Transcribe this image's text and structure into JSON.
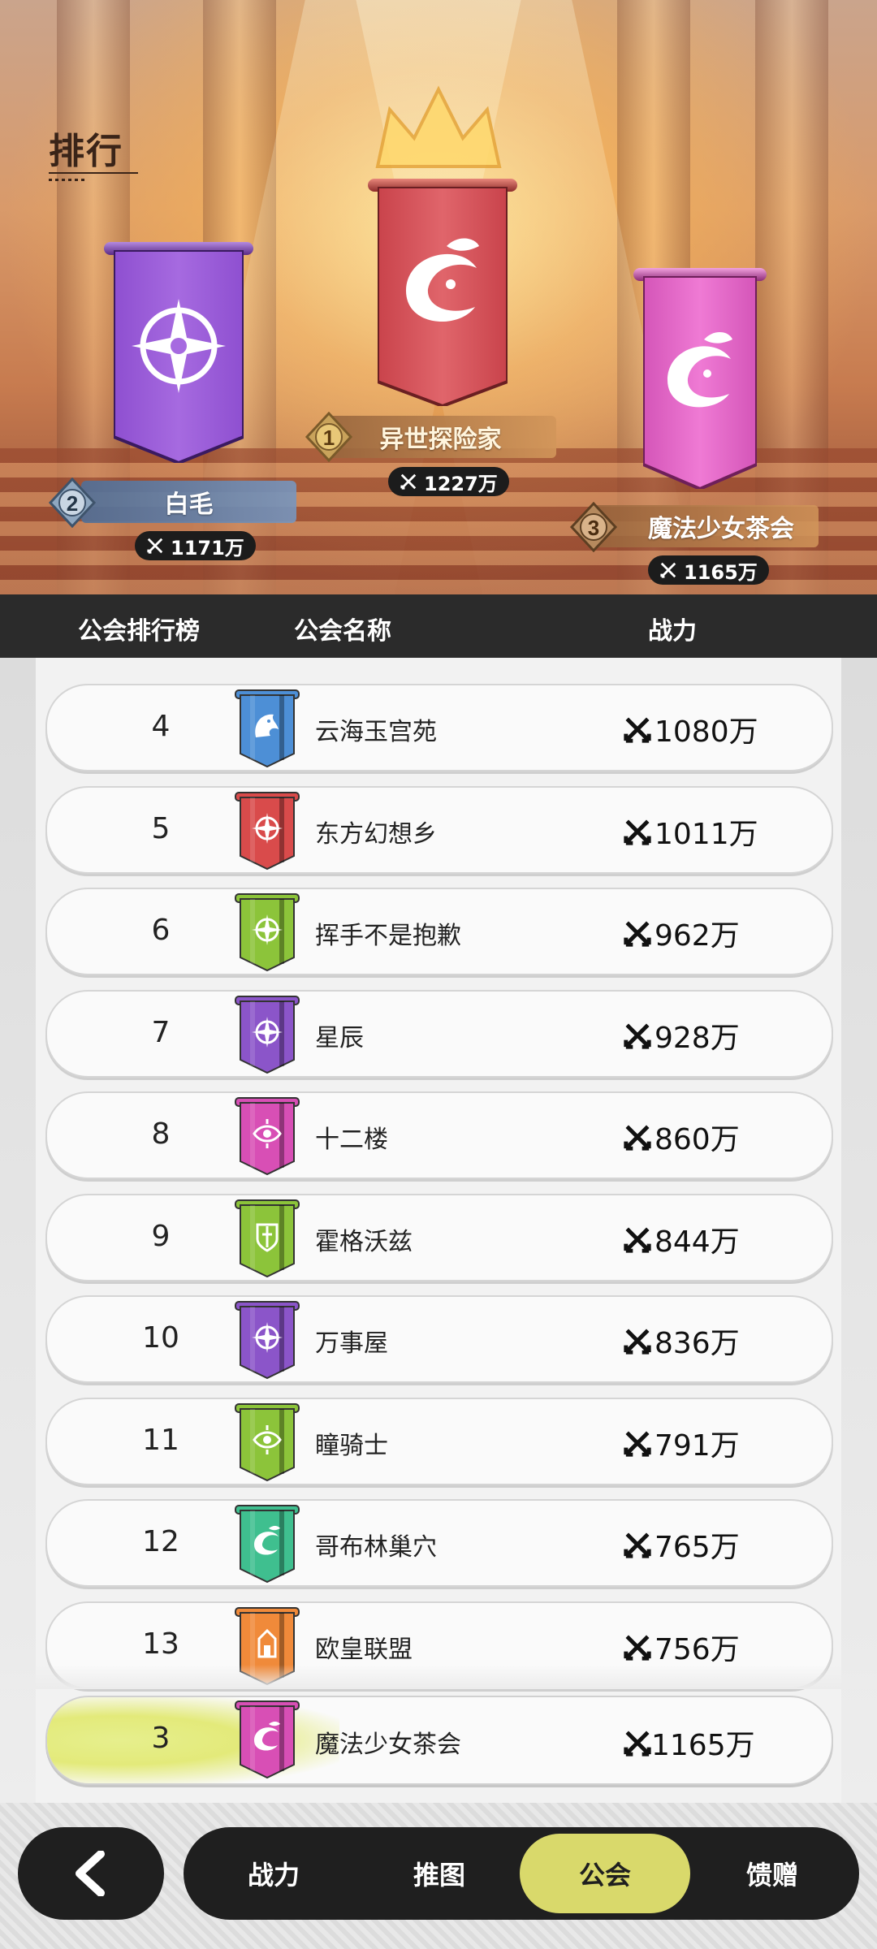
{
  "page": {
    "title": "排行"
  },
  "top3": [
    {
      "rank": "2",
      "name": "白毛",
      "power": "1171万",
      "banner_color": "#9b5fd6",
      "emblem": "compass-star-icon"
    },
    {
      "rank": "1",
      "name": "异世探险家",
      "power": "1227万",
      "banner_color": "#d9545a",
      "emblem": "dragon-leaf-icon"
    },
    {
      "rank": "3",
      "name": "魔法少女茶会",
      "power": "1165万",
      "banner_color": "#e066c6",
      "emblem": "dragon-leaf-icon"
    }
  ],
  "table_header": {
    "rank": "公会排行榜",
    "name": "公会名称",
    "power": "战力"
  },
  "rows": [
    {
      "rank": "4",
      "name": "云海玉宫苑",
      "power": "1080万",
      "color": "#4d8fd6",
      "emblem": "dragon-icon"
    },
    {
      "rank": "5",
      "name": "东方幻想乡",
      "power": "1011万",
      "color": "#d94b4b",
      "emblem": "compass-star-icon"
    },
    {
      "rank": "6",
      "name": "挥手不是抱歉",
      "power": "962万",
      "color": "#8cc43a",
      "emblem": "compass-star-icon"
    },
    {
      "rank": "7",
      "name": "星辰",
      "power": "928万",
      "color": "#8b55c9",
      "emblem": "compass-star-icon"
    },
    {
      "rank": "8",
      "name": "十二楼",
      "power": "860万",
      "color": "#d84fb5",
      "emblem": "eye-icon"
    },
    {
      "rank": "9",
      "name": "霍格沃兹",
      "power": "844万",
      "color": "#8cc43a",
      "emblem": "sword-shield-icon"
    },
    {
      "rank": "10",
      "name": "万事屋",
      "power": "836万",
      "color": "#8b55c9",
      "emblem": "compass-star-icon"
    },
    {
      "rank": "11",
      "name": "瞳骑士",
      "power": "791万",
      "color": "#8cc43a",
      "emblem": "eye-icon"
    },
    {
      "rank": "12",
      "name": "哥布林巢穴",
      "power": "765万",
      "color": "#3fbf8f",
      "emblem": "dragon-leaf-icon"
    },
    {
      "rank": "13",
      "name": "欧皇联盟",
      "power": "756万",
      "color": "#f08a3a",
      "emblem": "tower-icon"
    }
  ],
  "my_guild": {
    "rank": "3",
    "name": "魔法少女茶会",
    "power": "1165万",
    "color": "#d84fb5",
    "emblem": "dragon-leaf-icon"
  },
  "nav": {
    "back_icon": "chevron-left-icon",
    "tabs": [
      {
        "label": "战力",
        "active": false
      },
      {
        "label": "推图",
        "active": false
      },
      {
        "label": "公会",
        "active": true
      },
      {
        "label": "馈赠",
        "active": false
      }
    ]
  },
  "colors": {
    "accent": "#d9d96b",
    "dark": "#1f1f1f"
  }
}
